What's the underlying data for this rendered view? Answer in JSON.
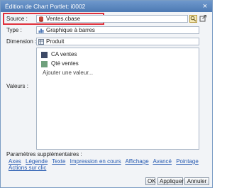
{
  "dialog": {
    "title": "Édition de Chart Portlet: i0002",
    "close": "×"
  },
  "form": {
    "source_label": "Source :",
    "source_value": "Ventes.cbase",
    "type_label": "Type :",
    "type_value": "Graphique à barres",
    "dimension_label": "Dimension :",
    "dimension_value": "Produit",
    "values_label": "Valeurs :"
  },
  "values": {
    "items": [
      {
        "label": "CA ventes",
        "color": "#3d4a66"
      },
      {
        "label": "Qté ventes",
        "color": "#6fa07c"
      }
    ],
    "add": "Ajouter une valeur..."
  },
  "params": {
    "label": "Paramètres supplémentaires :",
    "links": [
      "Axes",
      "Légende",
      "Texte",
      "Impression en cours",
      "Affichage",
      "Avancé",
      "Pointage",
      "Actions sur clic"
    ]
  },
  "buttons": {
    "ok": "OK",
    "apply": "Appliquer",
    "cancel": "Annuler"
  },
  "colors": {
    "highlight": "#e0303b",
    "link": "#2559b0",
    "titlebar": "#5a86bf"
  }
}
